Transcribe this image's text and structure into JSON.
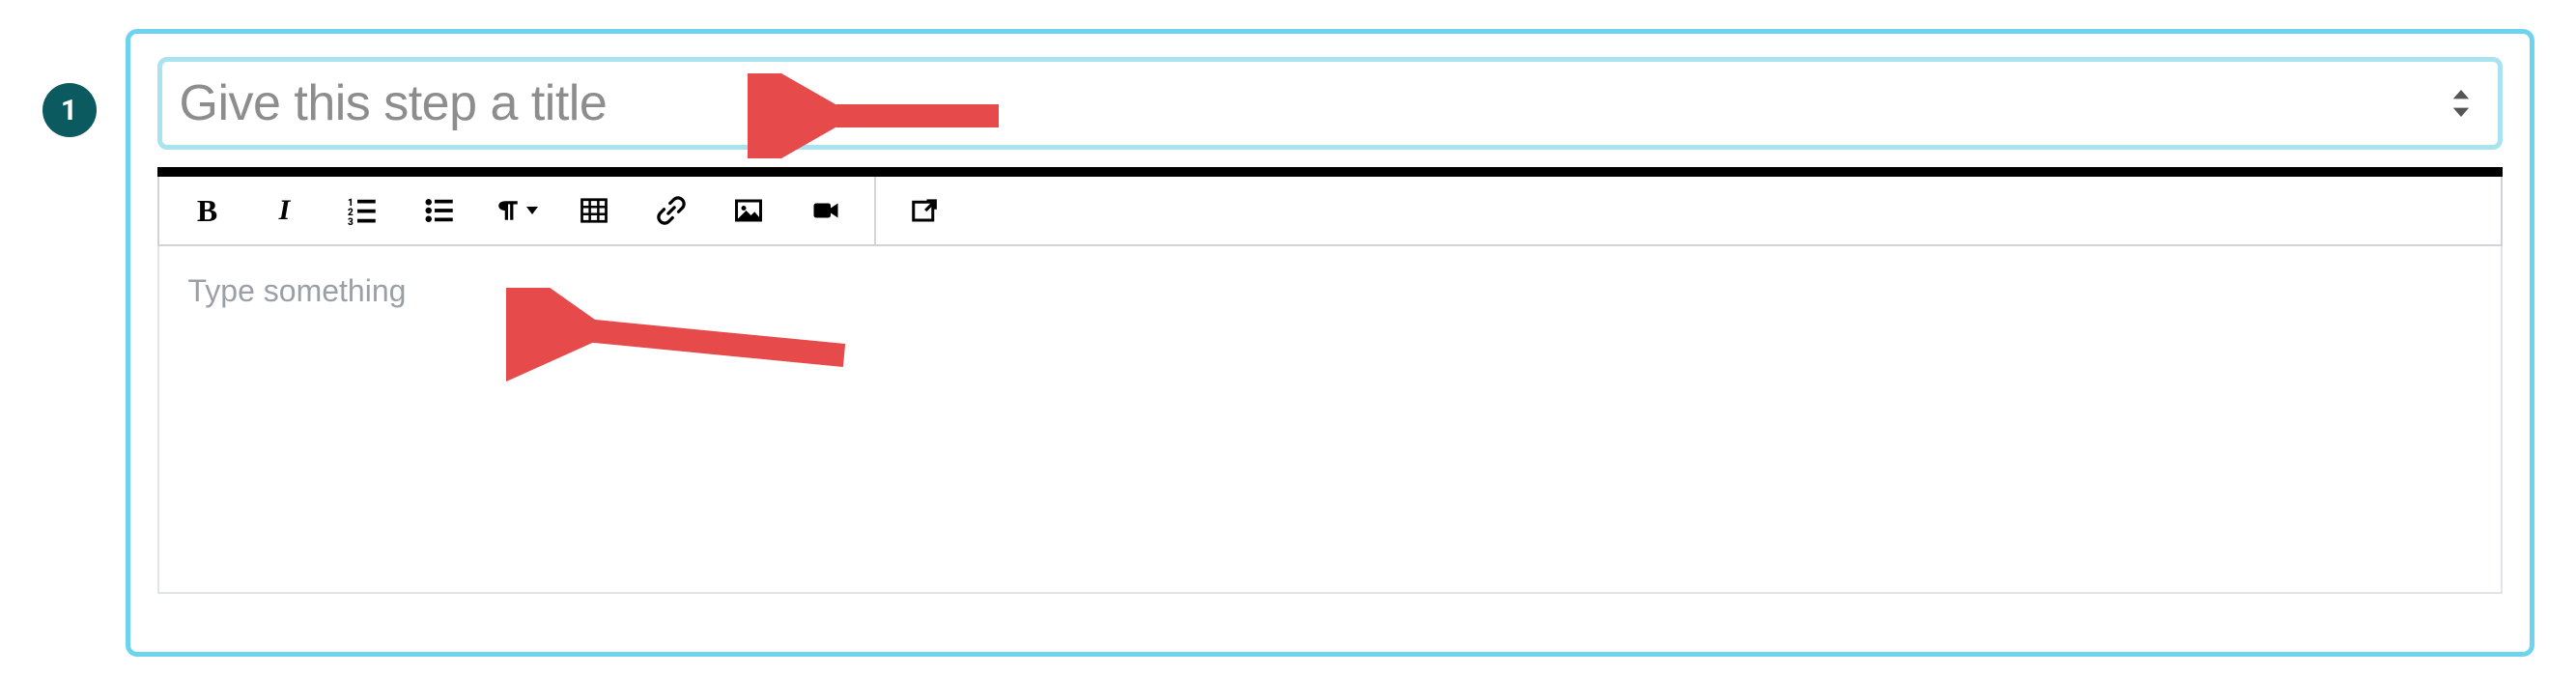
{
  "step": {
    "number": "1",
    "title_value": "",
    "title_placeholder": "Give this step a title"
  },
  "editor": {
    "body_value": "",
    "body_placeholder": "Type something"
  },
  "toolbar": {
    "bold_label": "B",
    "italic_label": "I"
  },
  "icons": {
    "ordered_list": "ordered-list-icon",
    "unordered_list": "unordered-list-icon",
    "paragraph_format": "paragraph-format-icon",
    "table": "table-icon",
    "link": "link-icon",
    "image": "image-icon",
    "video": "video-icon",
    "fullscreen": "fullscreen-icon",
    "sort_handle": "sort-handle-icon"
  },
  "colors": {
    "card_border": "#6cd4ee",
    "title_border": "#a9e3f0",
    "badge_bg": "#0b5a60",
    "separator": "#000000",
    "arrow": "#e64a4a"
  }
}
